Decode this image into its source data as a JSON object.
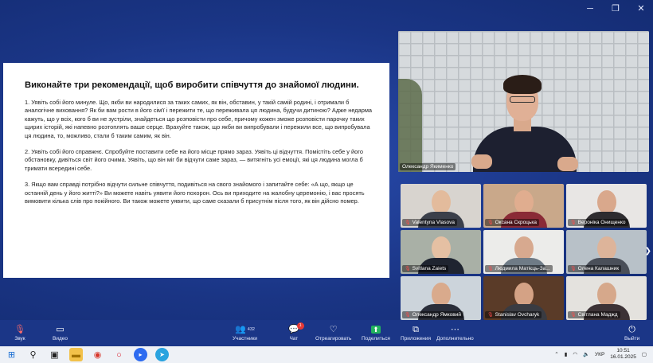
{
  "window": {
    "minimize": "─",
    "restore": "❐",
    "close": "✕"
  },
  "slide": {
    "title": "Виконайте три рекомендації, щоб виробити співчуття до знайомої людини.",
    "paragraphs": [
      "1. Уявіть собі його минуле. Що, якби ви народилися за таких самих, як він, обставин, у такій самій родині, і отримали б аналогічне виховання? Як би вам рости в його сім'ї і пережити те, що переживала ця людина, будучи дитиною? Адже недарма кажуть, що у всіх, кого б ви не зустріли, знайдеться що розповісти про себе, причому кожен зможе розповісти парочку таких щирих історій, які напевно розтоплять ваше серце. Врахуйте також, що якби ви випробували і пережили все, що випробувала ця людина, то, можливо, стали б таким самим, як він.",
      "2. Уявіть собі його справжнє. Спробуйте поставити себе на його місце прямо зараз. Уявіть ці відчуття. Помістіть себе у його обстановку, дивіться світ його очима. Уявіть, що він міг би відчути саме зараз, — витягніть усі емоції, які ця людина могла б тримати всередині себе.",
      "3. Якщо вам справді потрібно відчути сильне співчуття, подивіться на свого знайомого і запитайте себе: «А що, якщо це останній день у його житті?» Ви можете навіть уявити його похорон. Ось ви приходите на жалобну церемонію, і вас просять вимовити кілька слів про покійного. Ви також можете уявити, що саме сказали б присутнім після того, як він дійсно помер."
    ]
  },
  "speaker": {
    "name": "Олександр Якименко"
  },
  "gallery": [
    {
      "name": "Valentyna Vlasova",
      "bg": "#d8d4cf",
      "face": "#e3bb9c",
      "shirt": "#3b3f4a"
    },
    {
      "name": "Оксана Скроцька",
      "bg": "#c9a88a",
      "face": "#e0ad8f",
      "shirt": "#8a2a36"
    },
    {
      "name": "Вероніка Онищенко",
      "bg": "#e8e6e4",
      "face": "#d9a88c",
      "shirt": "#2e2c2f"
    },
    {
      "name": "Svitlana Zaiets",
      "bg": "#a9b0a6",
      "face": "#e5c0a3",
      "shirt": "#1f2430"
    },
    {
      "name": "Людмила Матієць-За...",
      "bg": "#ececea",
      "face": "#d7a98f",
      "shirt": "#6f7b86"
    },
    {
      "name": "Олена Калашник",
      "bg": "#b8c1c8",
      "face": "#ddb49a",
      "shirt": "#4a4f59"
    },
    {
      "name": "Олександр Ямковий",
      "bg": "#ccd4db",
      "face": "#d9aa8c",
      "shirt": "#2a2e3a"
    },
    {
      "name": "Stanislav Ovcharyk",
      "bg": "#5a3b28",
      "face": "#d4a285",
      "shirt": "#393b42"
    },
    {
      "name": "Світлана Маджд",
      "bg": "#e4e2de",
      "face": "#d6a88b",
      "shirt": "#3c3236"
    }
  ],
  "toolbar": {
    "audio": "Звук",
    "video": "Видео",
    "participants": "Участники",
    "participants_count": "432",
    "chat": "Чат",
    "chat_badge": "1",
    "react": "Отреагировать",
    "share": "Поделиться",
    "apps": "Приложения",
    "more": "Дополнительно",
    "leave": "Выйти"
  },
  "taskbar": {
    "lang": "УКР",
    "time": "10:51",
    "date": "16.01.2025"
  },
  "colors": {
    "accent": "#1f3b8c",
    "share": "#22b35e",
    "danger": "#e53935"
  }
}
